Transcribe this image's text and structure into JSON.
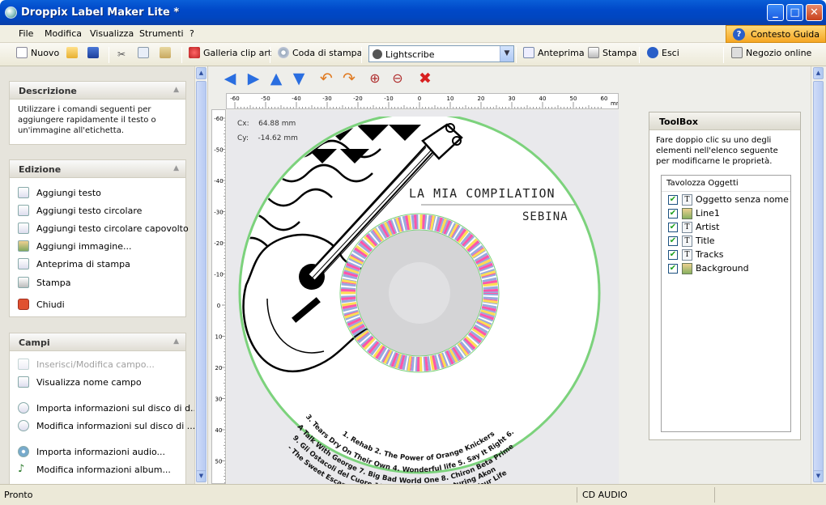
{
  "window": {
    "title": "Droppix Label Maker Lite *",
    "minimize": "_",
    "maximize": "□",
    "close": "✕"
  },
  "menu": {
    "items": [
      "File",
      "Modifica",
      "Visualizza",
      "Strumenti",
      "?"
    ],
    "help": "Contesto Guida",
    "help_icon": "?"
  },
  "toolbar": {
    "new_label": "Nuovo",
    "clipart_label": "Galleria clip art",
    "printqueue_label": "Coda di stampa",
    "combo_value": "Lightscribe",
    "preview_label": "Anteprima",
    "print_label": "Stampa",
    "exit_label": "Esci",
    "shop_label": "Negozio online"
  },
  "sidebar": {
    "descrizione": {
      "title": "Descrizione",
      "text": "Utilizzare i comandi seguenti per aggiungere rapidamente il testo o un'immagine all'etichetta."
    },
    "edizione": {
      "title": "Edizione",
      "items": [
        "Aggiungi testo",
        "Aggiungi testo circolare",
        "Aggiungi testo circolare capovolto",
        "Aggiungi immagine...",
        "Anteprima di stampa",
        "Stampa",
        "Chiudi"
      ]
    },
    "campi": {
      "title": "Campi",
      "items": [
        "Inserisci/Modifica campo...",
        "Visualizza nome campo",
        "Importa informazioni sul disco di d...",
        "Modifica informazioni sul disco di ...",
        "Importa informazioni audio...",
        "Modifica informazioni album..."
      ]
    }
  },
  "ruler": {
    "unit": "mm",
    "top": [
      "-60",
      "-50",
      "-40",
      "-30",
      "-20",
      "-10",
      "0",
      "10",
      "20",
      "30",
      "40",
      "50",
      "60"
    ],
    "left": [
      "-60",
      "-50",
      "-40",
      "-30",
      "-20",
      "-10",
      "0",
      "10",
      "20",
      "30",
      "40",
      "50",
      "60"
    ]
  },
  "coords": {
    "cx_label": "Cx:",
    "cx_value": "64.88 mm",
    "cy_label": "Cy:",
    "cy_value": "-14.62 mm"
  },
  "cd": {
    "title": "LA MIA COMPILATION",
    "artist": "SEBINA",
    "tracks_line1": "1. Rehab 2. The Power of Orange Knickers",
    "tracks_line2": "3. Tears Dry On Their Own 4. Wonderful life 5. Say It Right 6.",
    "tracks_line3": "A Talk With George 7. Big Bad World One 8. Chiron Beta Prime",
    "tracks_line4": "9. Gli Ostacoli del Cuore 10. Gwen Stefani featuring Akon",
    "tracks_line5": "- The Sweet Escape 11. Hometown Glory 12. Time of Your Life"
  },
  "toolbox": {
    "title": "ToolBox",
    "description": "Fare doppio clic su uno degli elementi nell'elenco seguente per modificarne le proprietà.",
    "list_title": "Tavolozza Oggetti",
    "items": [
      {
        "label": "Oggetto senza nome",
        "icon": "text-icon"
      },
      {
        "label": "Line1",
        "icon": "image-icon"
      },
      {
        "label": "Artist",
        "icon": "text-icon"
      },
      {
        "label": "Title",
        "icon": "text-icon"
      },
      {
        "label": "Tracks",
        "icon": "text-icon"
      },
      {
        "label": "Background",
        "icon": "image-icon"
      }
    ]
  },
  "status": {
    "left": "Pronto",
    "middle": "CD AUDIO"
  }
}
